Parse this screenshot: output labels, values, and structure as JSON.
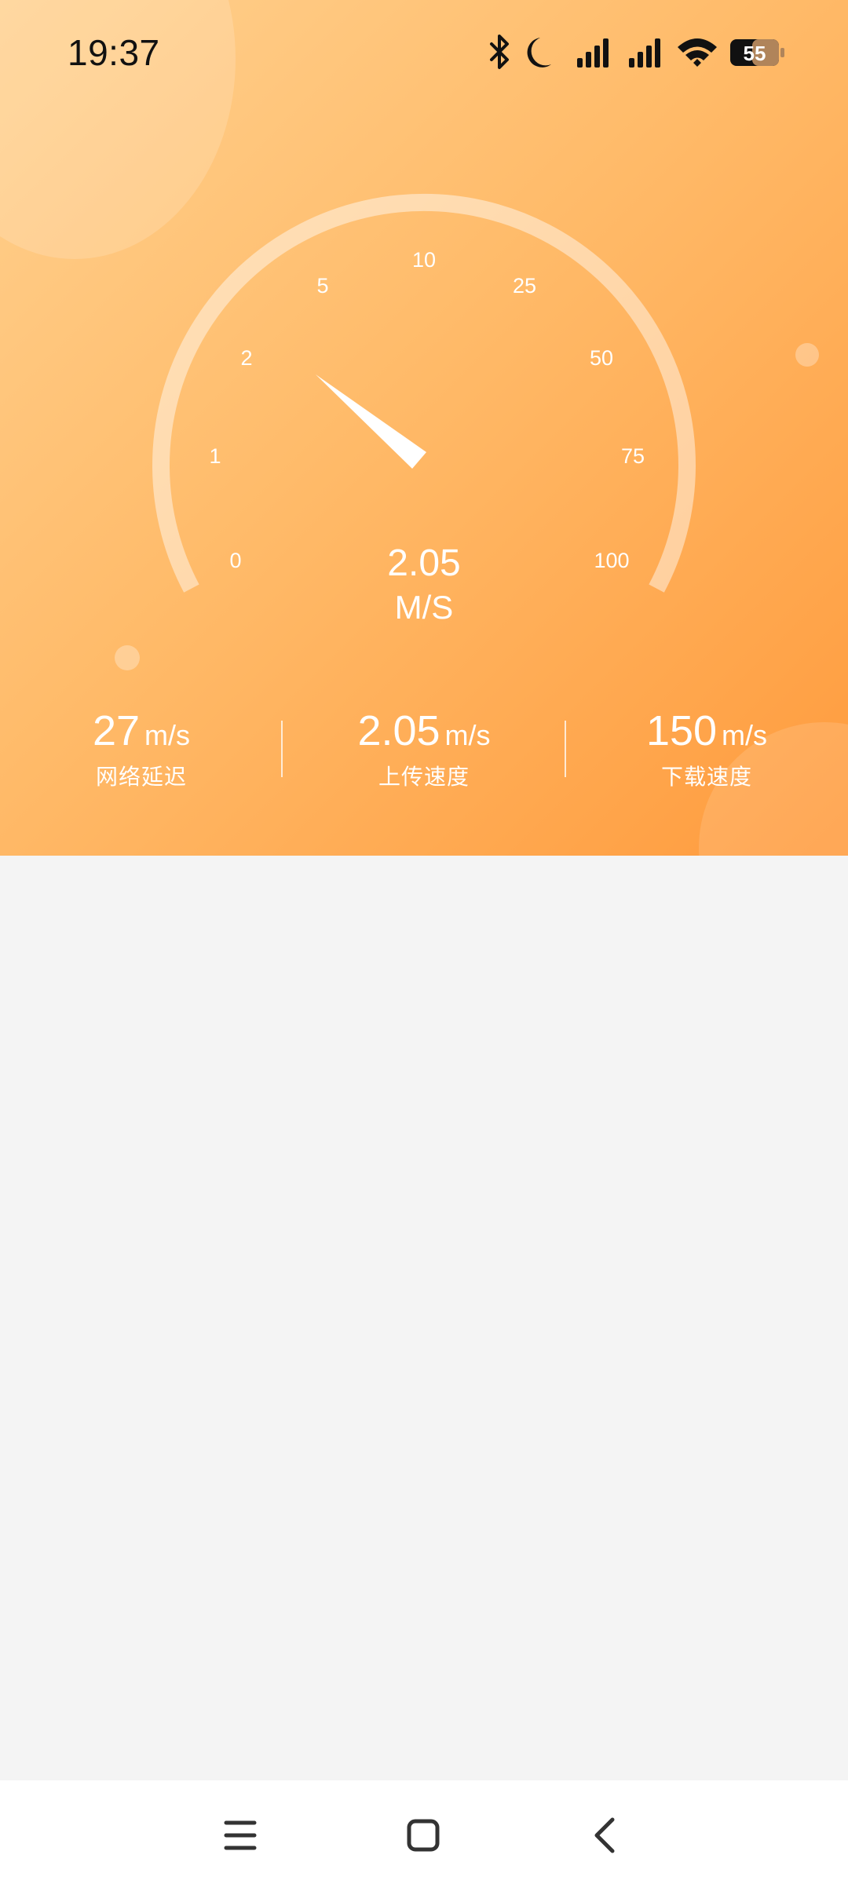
{
  "status_bar": {
    "time": "19:37",
    "battery": "55",
    "icons": [
      "bluetooth-icon",
      "moon-icon",
      "signal-icon",
      "signal-icon",
      "wifi-icon",
      "battery-icon"
    ]
  },
  "gauge": {
    "ticks": [
      "0",
      "1",
      "2",
      "5",
      "10",
      "25",
      "50",
      "75",
      "100"
    ],
    "value": "2.05",
    "unit": "M/S",
    "track_color": "rgba(255,255,255,0.45)",
    "needle_color": "#ffffff"
  },
  "stats": [
    {
      "value": "27",
      "unit": "m/s",
      "label": "网络延迟"
    },
    {
      "value": "2.05",
      "unit": "m/s",
      "label": "上传速度"
    },
    {
      "value": "150",
      "unit": "m/s",
      "label": "下载速度"
    }
  ],
  "nav_bar": {
    "buttons": [
      "menu-icon",
      "home-icon",
      "back-icon"
    ]
  },
  "colors": {
    "gradient_start": "#ffd18f",
    "gradient_end": "#ff9b3d",
    "content_bg": "#f4f4f4"
  }
}
